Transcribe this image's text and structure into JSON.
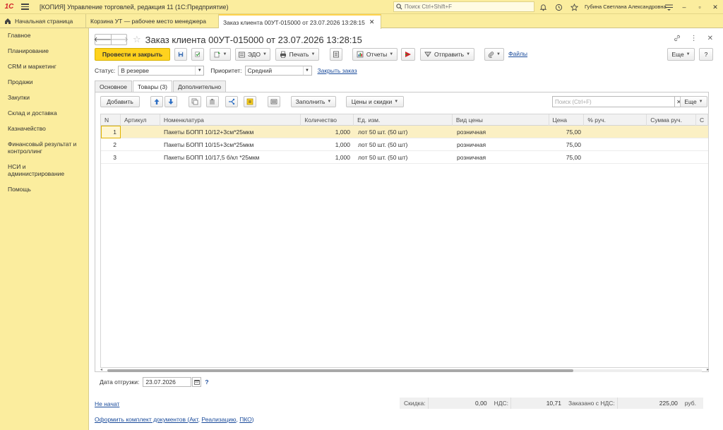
{
  "app": {
    "logo": "1С",
    "title": "[КОПИЯ] Управление торговлей, редакция 11  (1С:Предприятие)",
    "search_placeholder": "Поиск Ctrl+Shift+F",
    "user": "Губина Светлана Александровна"
  },
  "tabs": [
    {
      "label": "Начальная страница"
    },
    {
      "label": "Корзина УТ — рабочее место менеджера"
    },
    {
      "label": "Заказ клиента 00УТ-015000 от 23.07.2026 13:28:15"
    }
  ],
  "sidebar": {
    "items": [
      {
        "label": "Главное"
      },
      {
        "label": "Планирование"
      },
      {
        "label": "CRM и маркетинг"
      },
      {
        "label": "Продажи"
      },
      {
        "label": "Закупки"
      },
      {
        "label": "Склад и доставка"
      },
      {
        "label": "Казначейство"
      },
      {
        "label": "Финансовый результат и контроллинг"
      },
      {
        "label": "НСИ и администрирование"
      },
      {
        "label": "Помощь"
      }
    ]
  },
  "document": {
    "title": "Заказ клиента 00УТ-015000 от 23.07.2026 13:28:15"
  },
  "toolbar": {
    "post_close": "Провести и закрыть",
    "edo": "ЭДО",
    "print": "Печать",
    "reports": "Отчеты",
    "send": "Отправить",
    "files": "Файлы",
    "more": "Еще",
    "help": "?"
  },
  "status": {
    "status_label": "Статус:",
    "status_value": "В резерве",
    "priority_label": "Приоритет:",
    "priority_value": "Средний",
    "close_order": "Закрыть заказ"
  },
  "form_tabs": [
    {
      "label": "Основное"
    },
    {
      "label": "Товары (3)"
    },
    {
      "label": "Дополнительно"
    }
  ],
  "table_toolbar": {
    "add": "Добавить",
    "fill": "Заполнить",
    "prices": "Цены и скидки",
    "search_placeholder": "Поиск (Ctrl+F)",
    "more": "Еще"
  },
  "table": {
    "columns": [
      "N",
      "Артикул",
      "Номенклатура",
      "Количество",
      "Ед. изм.",
      "Вид цены",
      "Цена",
      "% руч.",
      "Сумма руч.",
      "С"
    ],
    "rows": [
      {
        "n": "1",
        "article": "",
        "name": "Пакеты БОПП 10/12+3см*25мкм",
        "qty": "1,000",
        "unit": "лот 50 шт. (50 шт)",
        "price_type": "розничная",
        "price": "75,00"
      },
      {
        "n": "2",
        "article": "",
        "name": "Пакеты БОПП 10/15+3см*25мкм",
        "qty": "1,000",
        "unit": "лот 50 шт. (50 шт)",
        "price_type": "розничная",
        "price": "75,00"
      },
      {
        "n": "3",
        "article": "",
        "name": "Пакеты БОПП 10/17,5 б/кл *25мкм",
        "qty": "1,000",
        "unit": "лот 50 шт. (50 шт)",
        "price_type": "розничная",
        "price": "75,00"
      }
    ]
  },
  "shipping": {
    "label": "Дата отгрузки:",
    "date": "23.07.2026",
    "hint": "?"
  },
  "footer": {
    "state_link": "Не начат",
    "discount_label": "Скидка:",
    "discount_value": "0,00",
    "vat_label": "НДС:",
    "vat_value": "10,71",
    "ordered_label": "Заказано с НДС:",
    "ordered_value": "225,00",
    "currency": "руб.",
    "docs_prefix": "Оформить комплект документов (",
    "docs_act": "Акт",
    "docs_sep1": ", ",
    "docs_realization": "Реализацию",
    "docs_sep2": ", ",
    "docs_pko": "ПКО",
    "docs_suffix": ")"
  },
  "colors": {
    "accent": "#ffd21e",
    "panel": "#fbed9e",
    "selected_row": "#fbf0c4",
    "link": "#1a4b9b"
  }
}
